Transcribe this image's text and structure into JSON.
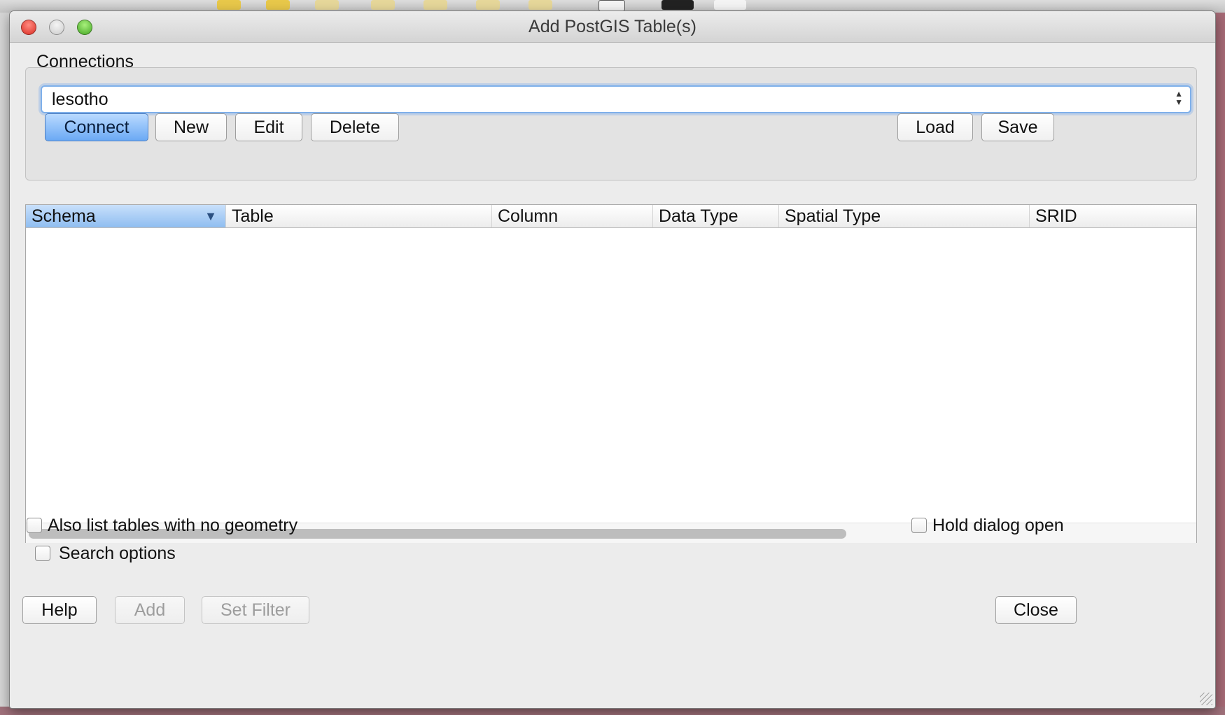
{
  "window": {
    "title": "Add PostGIS Table(s)"
  },
  "connections": {
    "group_label": "Connections",
    "selected_connection": "lesotho",
    "buttons": {
      "connect": "Connect",
      "new": "New",
      "edit": "Edit",
      "delete": "Delete",
      "load": "Load",
      "save": "Save"
    }
  },
  "table": {
    "columns": [
      "Schema",
      "Table",
      "Column",
      "Data Type",
      "Spatial Type",
      "SRID"
    ],
    "sorted_column": "Schema",
    "rows": []
  },
  "options": {
    "list_no_geometry": {
      "label": "Also list tables with no geometry",
      "checked": false
    },
    "search_options": {
      "label": "Search options",
      "checked": false
    },
    "hold_dialog_open": {
      "label": "Hold dialog open",
      "checked": false
    }
  },
  "footer": {
    "help": "Help",
    "add": "Add",
    "set_filter": "Set Filter",
    "close": "Close"
  },
  "colors": {
    "primary_button": "#6ba9f4",
    "focus_ring": "#7fb0ea",
    "sorted_header": "#8fbdf0"
  }
}
